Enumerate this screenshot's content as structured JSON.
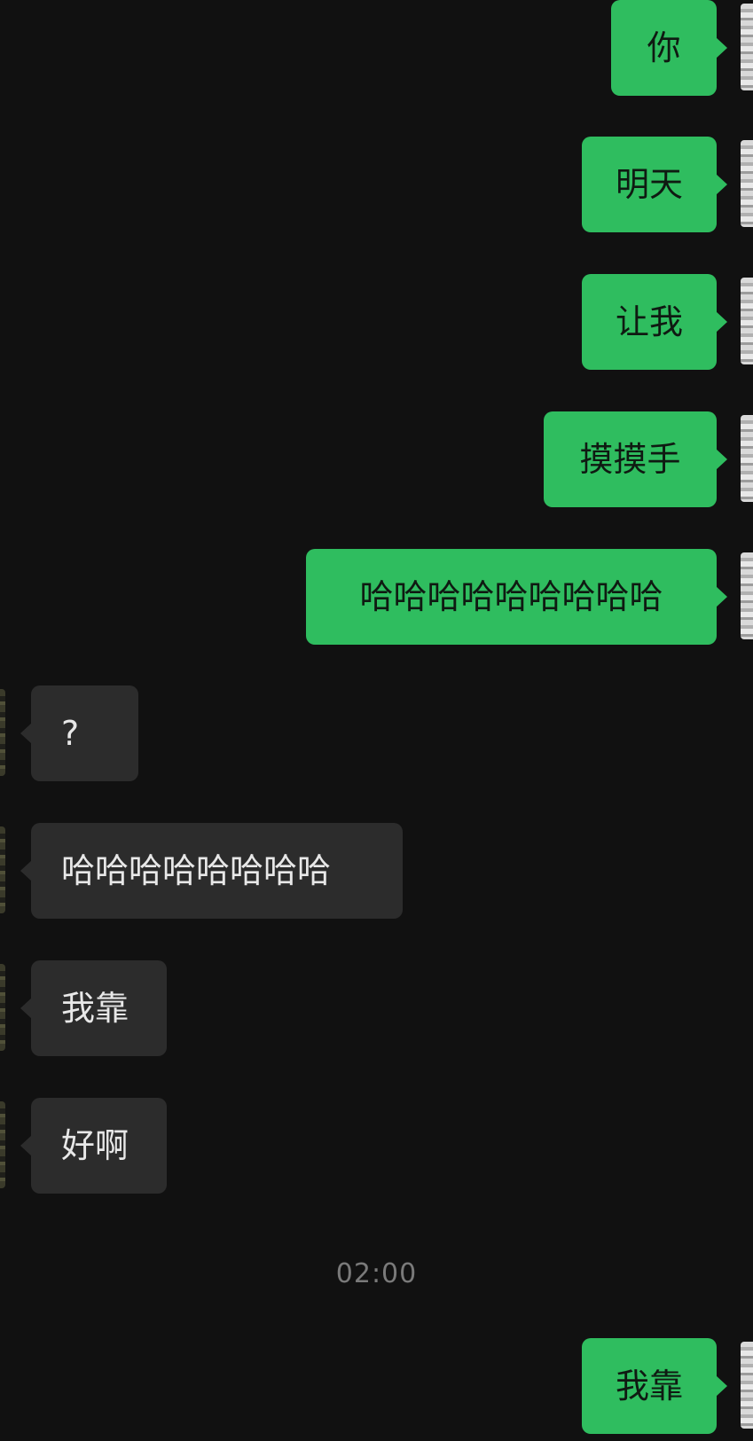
{
  "conversation": {
    "sent_1": "你",
    "sent_2": "明天",
    "sent_3": "让我",
    "sent_4": "摸摸手",
    "sent_5": "哈哈哈哈哈哈哈哈哈",
    "received_1": "?",
    "received_2": "哈哈哈哈哈哈哈哈",
    "received_3": "我靠",
    "received_4": "好啊",
    "timestamp": "02:00",
    "sent_6": "我靠"
  },
  "colors": {
    "background": "#111111",
    "sent_bubble": "#2fbd5f",
    "received_bubble": "#2c2c2c",
    "timestamp_text": "#7a7a7a"
  }
}
